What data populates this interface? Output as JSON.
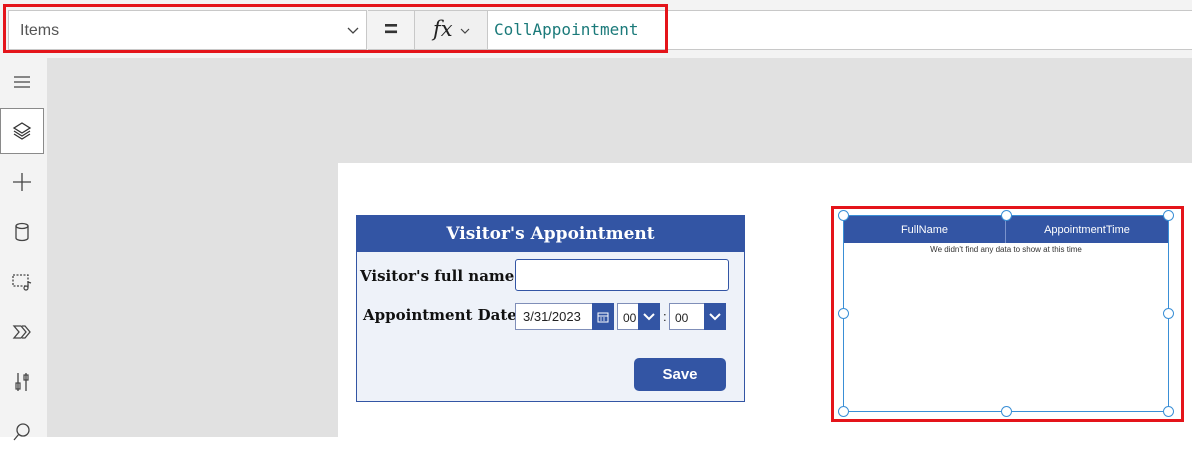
{
  "formula_bar": {
    "property": "Items",
    "equals": "=",
    "fx": "fx",
    "formula": "CollAppointment"
  },
  "rail": {
    "icons": [
      "hamburger-menu-icon",
      "tree-view-layers-icon",
      "insert-plus-icon",
      "data-cylinder-icon",
      "media-icon",
      "power-automate-icon",
      "advanced-tools-icon",
      "search-icon"
    ]
  },
  "form": {
    "title": "Visitor's Appointment",
    "name_label": "Visitor's full name:",
    "name_value": "",
    "date_label": "Appointment Date:",
    "date_value": "3/31/2023",
    "hour_value": "00",
    "minute_value": "00",
    "colon": ":",
    "save_label": "Save"
  },
  "table": {
    "columns": [
      "FullName",
      "AppointmentTime"
    ],
    "empty_message": "We didn't find any data to show at this time"
  },
  "colors": {
    "accent": "#3355a4",
    "highlight": "#e4141a",
    "formula_text": "#1b7a7a",
    "selection": "#3a8fd6"
  }
}
